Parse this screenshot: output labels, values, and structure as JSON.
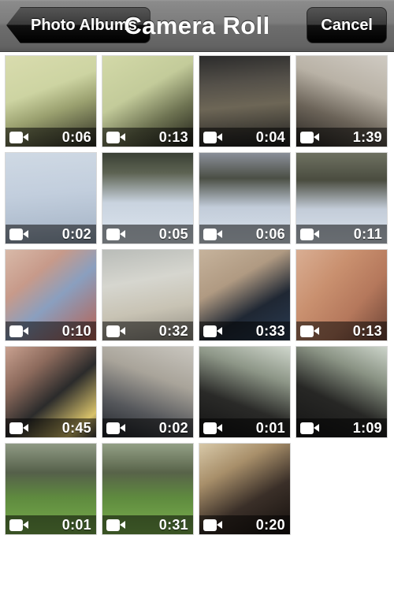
{
  "nav": {
    "back_label": "Photo Albums",
    "title": "Camera Roll",
    "cancel_label": "Cancel"
  },
  "icons": {
    "video_badge": "video-camera-icon",
    "back_chevron": "chevron-left-icon"
  },
  "colors": {
    "nav_bar_top": "#9a9a9a",
    "nav_bar_bottom": "#585858",
    "button_fill": "#000000",
    "badge_overlay": "rgba(0,0,0,0.52)",
    "text": "#ffffff",
    "page_background": "#ffffff"
  },
  "grid": {
    "columns": 4,
    "count": 19,
    "items": [
      {
        "duration": "0:06",
        "scene": "man-dancing-living-room-green-wall",
        "art": "linear-gradient(160deg,#d9dcae 0%,#cdd4a2 38%,#9aa06f 60%,#2a2a20 100%)"
      },
      {
        "duration": "0:13",
        "scene": "two-people-room-green-wall",
        "art": "linear-gradient(150deg,#d3d9a8 0%,#c3cb9a 40%,#6e7352 68%,#1d1d16 100%)"
      },
      {
        "duration": "0:04",
        "scene": "winter-trees-through-window",
        "art": "linear-gradient(175deg,#2b2b2b 0%,#545049 30%,#6d6656 55%,#1c1c1c 100%)"
      },
      {
        "duration": "1:39",
        "scene": "children-and-adult-in-living-room",
        "art": "linear-gradient(200deg,#cfcac2 0%,#b9b2a6 35%,#6b6358 65%,#262320 100%)"
      },
      {
        "duration": "0:02",
        "scene": "child-sledding-on-snow",
        "art": "linear-gradient(175deg,#cfd9e4 0%,#c2cedd 45%,#aebccd 80%,#93a3b6 100%)"
      },
      {
        "duration": "0:05",
        "scene": "person-walking-up-snowy-hill",
        "art": "linear-gradient(180deg,#3a4035 0%,#5d6352 22%,#c9d3df 55%,#dde6ef 100%)"
      },
      {
        "duration": "0:06",
        "scene": "snowy-park-with-sledders",
        "art": "linear-gradient(180deg,#8a8f99 0%,#4b4f45 28%,#c2ccd9 60%,#d9e2ec 100%)"
      },
      {
        "duration": "0:11",
        "scene": "two-sledders-on-snow-slope",
        "art": "linear-gradient(180deg,#6e7161 0%,#4a4c3f 30%,#c3ccd8 62%,#dae3ed 100%)"
      },
      {
        "duration": "0:10",
        "scene": "boy-with-lego-blocks",
        "art": "linear-gradient(140deg,#d8b9a8 0%,#c79a8a 30%,#8a9fbf 55%,#b8604f 100%)"
      },
      {
        "duration": "0:32",
        "scene": "woman-in-kitchen",
        "art": "linear-gradient(170deg,#b9bcb8 0%,#d6d6cf 35%,#c8c3b4 65%,#8e8a80 100%)"
      },
      {
        "duration": "0:33",
        "scene": "child-with-tablet-on-bed",
        "art": "linear-gradient(150deg,#c6b39c 0%,#b09a82 35%,#1f2733 65%,#2a3b52 100%)"
      },
      {
        "duration": "0:13",
        "scene": "boy-and-adult-selfie",
        "art": "linear-gradient(130deg,#d9ae93 0%,#c9906f 35%,#b5785c 65%,#6d4436 100%)"
      },
      {
        "duration": "0:45",
        "scene": "hands-on-tablet-screen",
        "art": "linear-gradient(140deg,#c9a190 0%,#8c6a5c 28%,#2b2b2b 55%,#d8c26a 85%,#3a3a3a 100%)"
      },
      {
        "duration": "0:02",
        "scene": "child-in-hat-on-street",
        "art": "linear-gradient(200deg,#c9c6bf 0%,#a9a49a 35%,#56585c 68%,#1e2228 100%)"
      },
      {
        "duration": "0:01",
        "scene": "child-at-piano-by-window",
        "art": "linear-gradient(200deg,#cfd6cc 0%,#8d9687 30%,#2a2a28 62%,#121212 100%)"
      },
      {
        "duration": "1:09",
        "scene": "children-at-piano-by-window",
        "art": "linear-gradient(205deg,#ccd4ca 0%,#8a9384 28%,#272725 60%,#141414 100%)"
      },
      {
        "duration": "0:01",
        "scene": "adult-and-child-on-lawn",
        "art": "linear-gradient(180deg,#8f9a84 0%,#55604a 32%,#5f8b3f 60%,#78ac4c 100%)"
      },
      {
        "duration": "0:31",
        "scene": "man-carrying-child-on-lawn",
        "art": "linear-gradient(180deg,#93a086 0%,#586349 32%,#5f8b3f 60%,#7bb04e 100%)"
      },
      {
        "duration": "0:20",
        "scene": "woman-and-child-with-puppet-indoors",
        "art": "linear-gradient(150deg,#d7c8a8 0%,#a88f6a 30%,#3a2f28 62%,#15100d 100%)"
      }
    ]
  }
}
